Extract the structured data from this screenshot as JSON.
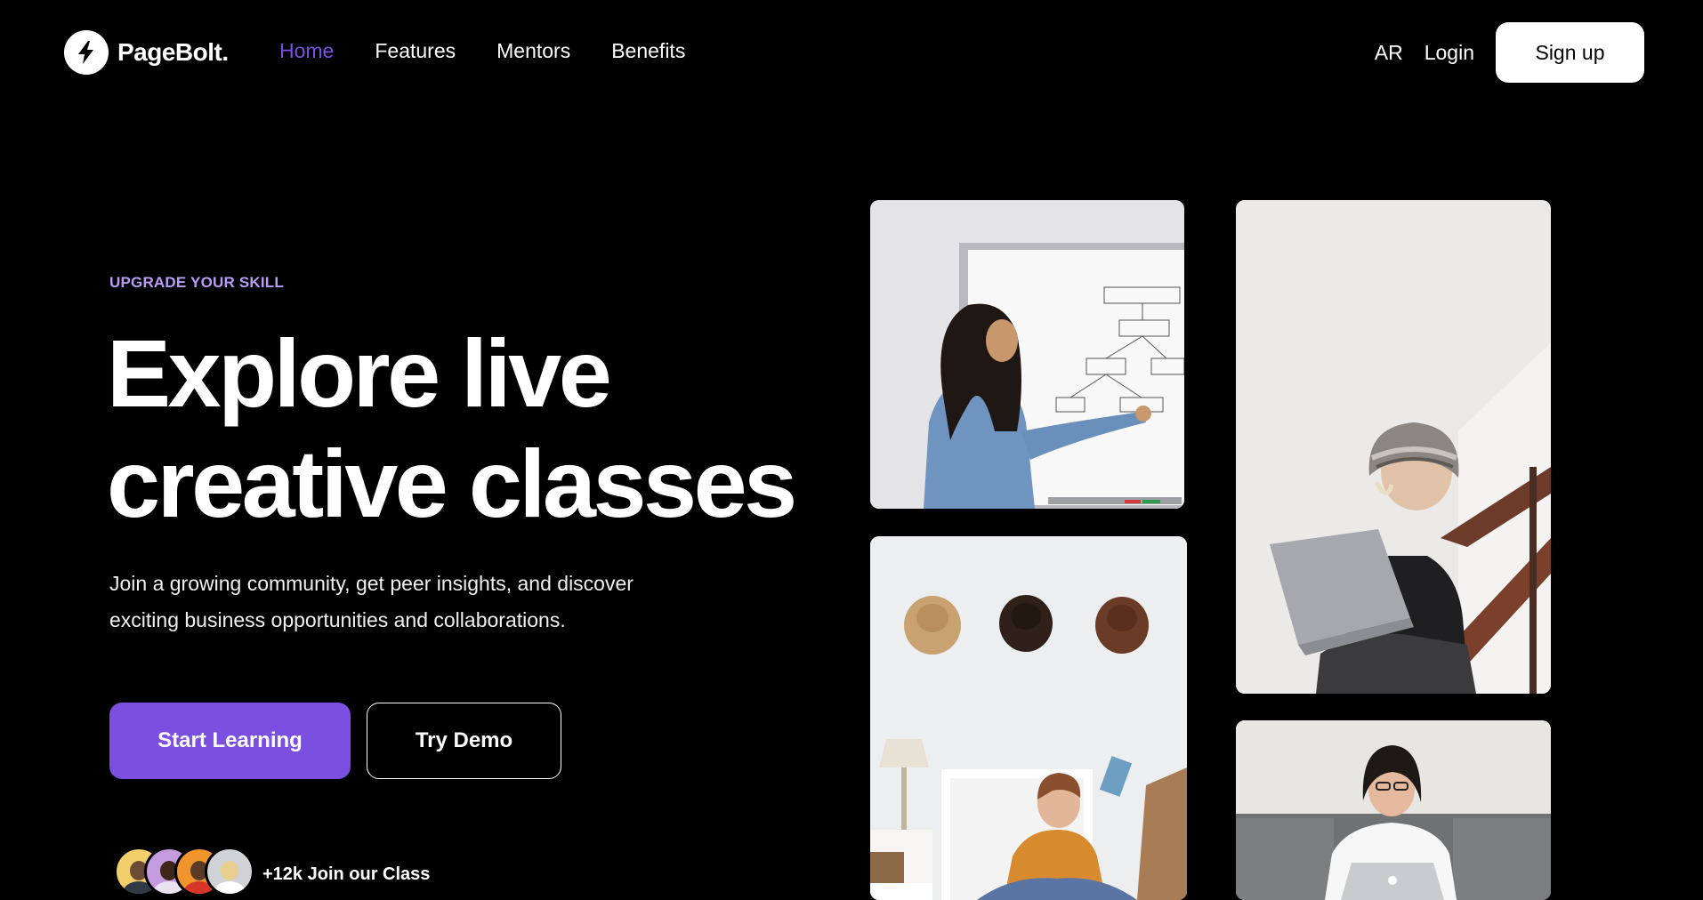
{
  "nav": {
    "brand": "PageBolt.",
    "links": [
      {
        "label": "Home",
        "active": true
      },
      {
        "label": "Features",
        "active": false
      },
      {
        "label": "Mentors",
        "active": false
      },
      {
        "label": "Benefits",
        "active": false
      }
    ],
    "lang": "AR",
    "login": "Login",
    "signup": "Sign up"
  },
  "hero": {
    "eyebrow": "UPGRADE YOUR SKILL",
    "headline_line1": "Explore live",
    "headline_line2": "creative classes",
    "subtext_line1": "Join a growing community, get peer insights, and discover",
    "subtext_line2": "exciting business opportunities and collaborations.",
    "primary_cta": "Start Learning",
    "secondary_cta": "Try Demo",
    "join_text": "+12k Join our Class"
  },
  "colors": {
    "accent": "#7b4fe0",
    "eyebrow": "#b89cf5",
    "background": "#000000"
  },
  "icons": {
    "logo": "bolt-icon"
  }
}
